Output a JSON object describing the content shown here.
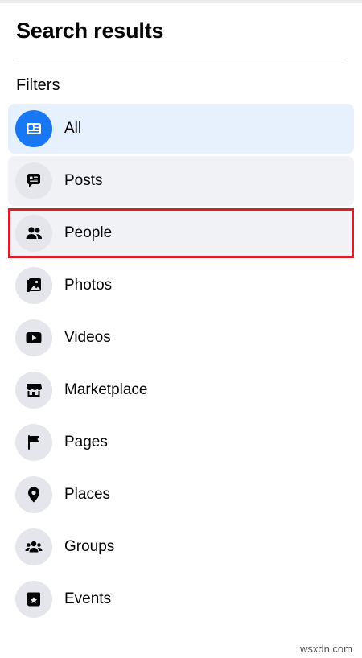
{
  "panel": {
    "title": "Search results",
    "filters_label": "Filters"
  },
  "filters": [
    {
      "label": "All",
      "icon": "news-feed-icon",
      "state": "active"
    },
    {
      "label": "Posts",
      "icon": "posts-icon",
      "state": "hover"
    },
    {
      "label": "People",
      "icon": "people-icon",
      "state": "highlight"
    },
    {
      "label": "Photos",
      "icon": "photos-icon",
      "state": "normal"
    },
    {
      "label": "Videos",
      "icon": "videos-icon",
      "state": "normal"
    },
    {
      "label": "Marketplace",
      "icon": "marketplace-icon",
      "state": "normal"
    },
    {
      "label": "Pages",
      "icon": "pages-flag-icon",
      "state": "normal"
    },
    {
      "label": "Places",
      "icon": "location-pin-icon",
      "state": "normal"
    },
    {
      "label": "Groups",
      "icon": "groups-icon",
      "state": "normal"
    },
    {
      "label": "Events",
      "icon": "events-icon",
      "state": "normal"
    }
  ],
  "colors": {
    "accent": "#1877f2",
    "active_bg": "#e7f0fd",
    "hover_bg": "#f0f2f5",
    "highlight_border": "#d61f26",
    "icon_bg": "#e4e6eb"
  },
  "watermark": "wsxdn.com"
}
